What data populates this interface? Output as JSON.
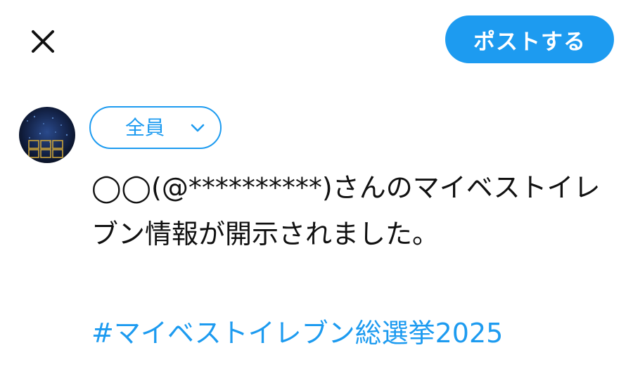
{
  "compose": {
    "post_button_label": "ポストする",
    "audience_label": "全員",
    "tweet_text": "◯◯(@**********)さんのマイベストイレブン情報が開示されました。",
    "hashtag": "#マイベストイレブン総選挙2025"
  },
  "icons": {
    "close": "close-icon",
    "chevron": "chevron-down-icon",
    "avatar": "avatar"
  },
  "colors": {
    "accent": "#1d9bf0",
    "text": "#111111",
    "background": "#ffffff"
  }
}
